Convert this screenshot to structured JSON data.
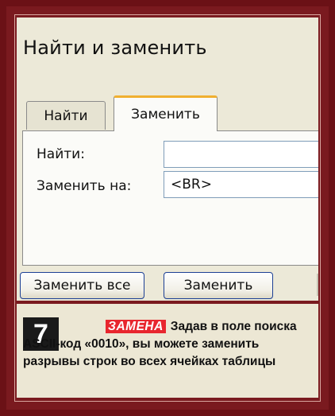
{
  "dialog": {
    "title": "Найти и заменить",
    "tabs": [
      {
        "label": "Найти"
      },
      {
        "label": "Заменить"
      }
    ],
    "find_label": "Найти:",
    "find_value": "",
    "replace_label": "Заменить на:",
    "replace_value": "<BR>",
    "buttons": {
      "replace_all": "Заменить все",
      "replace": "Заменить"
    }
  },
  "caption": {
    "step_number": "7",
    "keyword": "ЗАМЕНА",
    "text": "Задав в поле поиска ASCII-код «0010», вы можете заменить разрывы строк во всех ячейках таблицы"
  },
  "colors": {
    "frame": "#6b1116",
    "keyword_bg": "#e8262e",
    "active_tab_accent": "#f0b030"
  }
}
